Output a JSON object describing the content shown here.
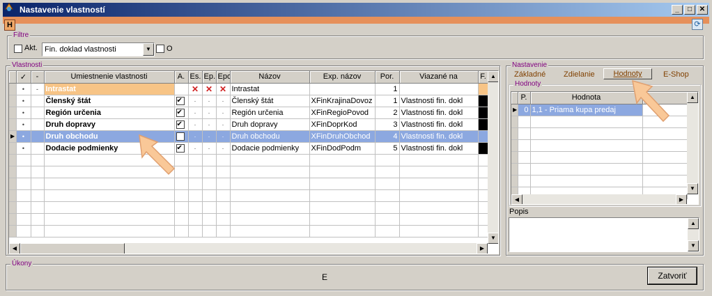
{
  "window": {
    "title": "Nastavenie vlastností",
    "badge": "H"
  },
  "filter": {
    "legend": "Filtre",
    "akt_label": "Akt.",
    "combo_value": "Fin. doklad vlastnosti",
    "o_label": "O"
  },
  "vlastnosti": {
    "legend": "Vlastnosti",
    "headers": [
      "✓",
      "-",
      "Umiestnenie vlastnosti",
      "A.",
      "Es.",
      "Ep.",
      "Epo",
      "Názov",
      "Exp. názov",
      "Por.",
      "Viazané na",
      "F."
    ],
    "rows": [
      {
        "check": "",
        "minus": "-",
        "umiestnenie": "Intrastat",
        "a": "",
        "es": "✕",
        "ep": "✕",
        "epo": "✕",
        "nazov": "Intrastat",
        "exp": "",
        "por": "1",
        "viazane": ""
      },
      {
        "check": "",
        "minus": "",
        "umiestnenie": "Členský štát",
        "a": "checked",
        "es": "·",
        "ep": "·",
        "epo": "·",
        "nazov": "Členský štát",
        "exp": "XFinKrajinaDovoz",
        "por": "1",
        "viazane": "Vlastnosti fin. dokl"
      },
      {
        "check": "",
        "minus": "",
        "umiestnenie": "Región určenia",
        "a": "checked",
        "es": "·",
        "ep": "·",
        "epo": "·",
        "nazov": "Región určenia",
        "exp": "XFinRegioPovod",
        "por": "2",
        "viazane": "Vlastnosti fin. dokl"
      },
      {
        "check": "",
        "minus": "",
        "umiestnenie": "Druh dopravy",
        "a": "checked",
        "es": "·",
        "ep": "·",
        "epo": "·",
        "nazov": "Druh dopravy",
        "exp": "XFinDoprKod",
        "por": "3",
        "viazane": "Vlastnosti fin. dokl"
      },
      {
        "check": "",
        "minus": "",
        "umiestnenie": "Druh obchodu",
        "a": "checked",
        "es": "·",
        "ep": "·",
        "epo": "·",
        "nazov": "Druh obchodu",
        "exp": "XFinDruhObchod",
        "por": "4",
        "viazane": "Vlastnosti fin. dokl"
      },
      {
        "check": "",
        "minus": "",
        "umiestnenie": "Dodacie podmienky",
        "a": "checked",
        "es": "·",
        "ep": "·",
        "epo": "·",
        "nazov": "Dodacie podmienky",
        "exp": "XFinDodPodm",
        "por": "5",
        "viazane": "Vlastnosti fin. dokl"
      }
    ]
  },
  "nastavenie": {
    "legend": "Nastavenie",
    "tabs": [
      "Základné",
      "Zdielanie",
      "Hodnoty",
      "E-Shop"
    ],
    "hodnoty_legend": "Hodnoty",
    "hodnoty_headers": [
      "P.",
      "Hodnota"
    ],
    "hodnoty_rows": [
      {
        "p": "0",
        "hodnota": "1,1 - Priama kupa predaj"
      }
    ],
    "popis_label": "Popis"
  },
  "ukony": {
    "legend": "Úkony",
    "center_text": "E",
    "close_label": "Zatvoriť"
  },
  "colors": {
    "title_start": "#0a246a",
    "title_end": "#a6caf0",
    "accent_orange": "#e6905a",
    "selection": "#8ca8e0",
    "legend_purple": "#800080"
  }
}
